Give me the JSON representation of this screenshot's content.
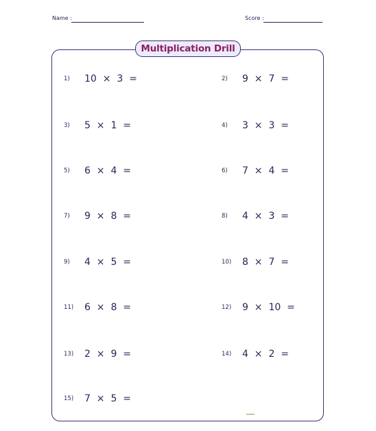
{
  "header": {
    "name_label": "Name :",
    "score_label": "Score :"
  },
  "title": "Multiplication Drill",
  "colors": {
    "title_text": "#8e1e64",
    "frame": "#3b2f78",
    "text": "#2a2458",
    "title_bg": "#ecebfb"
  },
  "problems": [
    {
      "number": "1)",
      "expression": "10  ×  3  ="
    },
    {
      "number": "2)",
      "expression": "9  ×  7  ="
    },
    {
      "number": "3)",
      "expression": "5  ×  1  ="
    },
    {
      "number": "4)",
      "expression": "3  ×  3  ="
    },
    {
      "number": "5)",
      "expression": "6  ×  4  ="
    },
    {
      "number": "6)",
      "expression": "7  ×  4  ="
    },
    {
      "number": "7)",
      "expression": "9  ×  8  ="
    },
    {
      "number": "8)",
      "expression": "4  ×  3  ="
    },
    {
      "number": "9)",
      "expression": "4  ×  5  ="
    },
    {
      "number": "10)",
      "expression": "8  ×  7  ="
    },
    {
      "number": "11)",
      "expression": "6  ×  8  ="
    },
    {
      "number": "12)",
      "expression": "9  ×  10  ="
    },
    {
      "number": "13)",
      "expression": "2  ×  9  ="
    },
    {
      "number": "14)",
      "expression": "4  ×  2  ="
    },
    {
      "number": "15)",
      "expression": "7  ×  5  ="
    }
  ]
}
